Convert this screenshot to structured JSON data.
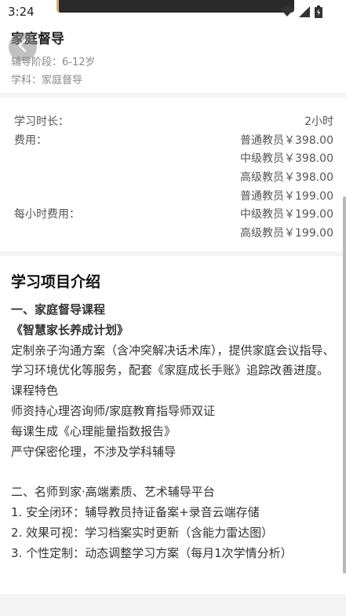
{
  "status_bar": {
    "time": "3:24"
  },
  "header": {
    "title": "家庭督导",
    "stage": "辅导阶段：6-12岁",
    "subject": "学科：家庭督导"
  },
  "fees": {
    "duration_label": "学习时长：",
    "duration_value": "2小时",
    "fee_label": "费用：",
    "fee_items": [
      "普通教员￥398.00",
      "中级教员￥398.00",
      "高级教员￥398.00",
      "普通教员￥199.00"
    ],
    "hourly_label": "每小时费用：",
    "hourly_items": [
      "中级教员￥199.00",
      "高级教员￥199.00"
    ]
  },
  "intro": {
    "title": "学习项目介绍",
    "lines": [
      "一、家庭督导课程",
      "《智慧家长养成计划》",
      "定制亲子沟通方案（含冲突解决话术库），提供家庭会议指导、学习环境优化等服务，配套《家庭成长手账》追踪改善进度。",
      "课程特色",
      "师资持心理咨询师/家庭教育指导师双证",
      "每课生成《心理能量指数报告》",
      "严守保密伦理，不涉及学科辅导",
      "",
      "二、名师到家·高端素质、艺术辅导平台",
      "1. 安全闭环：辅导教员持证备案+录音云端存储",
      "2. 效果可视：学习档案实时更新（含能力雷达图）",
      "3. 个性定制：动态调整学习方案（每月1次学情分析）"
    ]
  }
}
